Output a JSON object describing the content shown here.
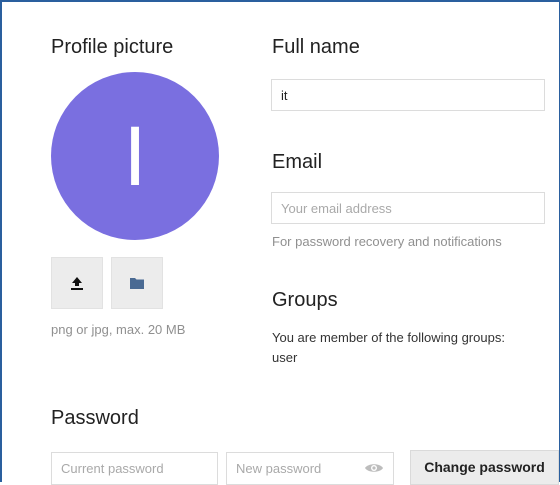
{
  "profile_picture": {
    "heading": "Profile picture",
    "avatar_letter": "I",
    "avatar_color": "#7a6fe0",
    "upload_icon": "upload-icon",
    "folder_icon": "folder-icon",
    "hint": "png or jpg, max. 20 MB"
  },
  "full_name": {
    "heading": "Full name",
    "value": "it"
  },
  "email": {
    "heading": "Email",
    "placeholder": "Your email address",
    "hint": "For password recovery and notifications"
  },
  "groups": {
    "heading": "Groups",
    "description": "You are member of the following groups:",
    "list": "user"
  },
  "password": {
    "heading": "Password",
    "current_placeholder": "Current password",
    "new_placeholder": "New password",
    "toggle_icon": "eye-icon",
    "change_label": "Change password"
  }
}
